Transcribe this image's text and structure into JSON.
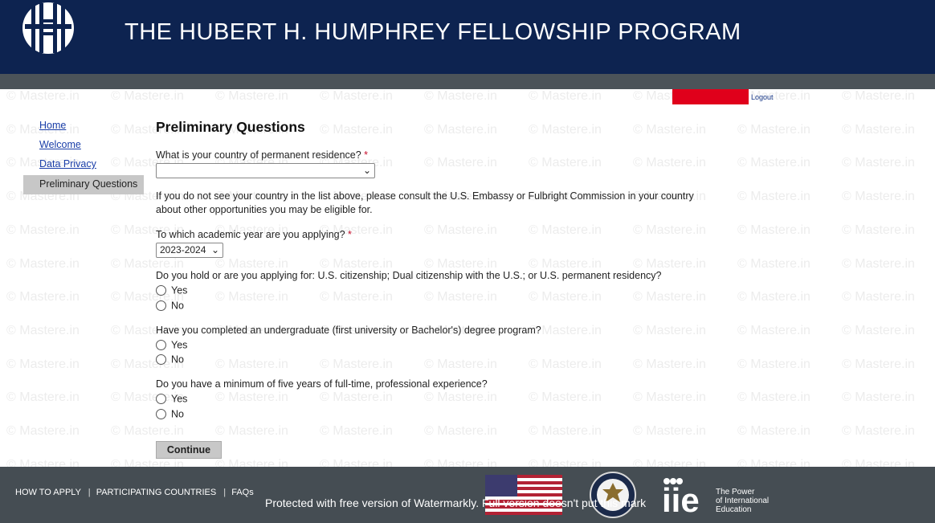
{
  "header": {
    "title": "THE HUBERT H. HUMPHREY FELLOWSHIP PROGRAM",
    "logo_icon": "humphrey-logo-icon"
  },
  "account": {
    "logout_label": "Logout"
  },
  "sidebar": {
    "items": [
      {
        "label": "Home",
        "active": false
      },
      {
        "label": "Welcome",
        "active": false
      },
      {
        "label": "Data Privacy",
        "active": false
      },
      {
        "label": "Preliminary Questions",
        "active": true
      }
    ]
  },
  "main": {
    "title": "Preliminary Questions",
    "q_country": "What is your country of permanent residence?",
    "required_mark": "*",
    "country_selected": "",
    "info_text": "If you do not see your country in the list above, please consult the U.S. Embassy or Fulbright Commission in your country about other opportunities you may be eligible for.",
    "q_year": "To which academic year are you applying?",
    "year_selected": "2023-2024",
    "q_citizenship": "Do you hold or are you applying for: U.S. citizenship; Dual citizenship with the U.S.; or U.S. permanent residency?",
    "q_degree": "Have you completed an undergraduate (first university or Bachelor's) degree program?",
    "q_experience": "Do you have a minimum of five years of full-time, professional experience?",
    "yes_label": "Yes",
    "no_label": "No",
    "continue_label": "Continue"
  },
  "background_watermark": "© Mastere.in",
  "footer": {
    "links": [
      "HOW TO APPLY",
      "PARTICIPATING COUNTRIES",
      "FAQs"
    ],
    "separator": "|",
    "iie_logo_text": "iie",
    "iie_tagline": [
      "The Power",
      "of International",
      "Education"
    ],
    "watermark_text": "Protected with free version of Watermarkly. Full version doesn't put this mark"
  },
  "colors": {
    "header_bg": "#0d2350",
    "band_gray": "#4b5359",
    "footer_bg": "#454d53",
    "link_blue": "#1a3ea8",
    "required_red": "#c8102e",
    "redaction_red": "#e0001b"
  }
}
